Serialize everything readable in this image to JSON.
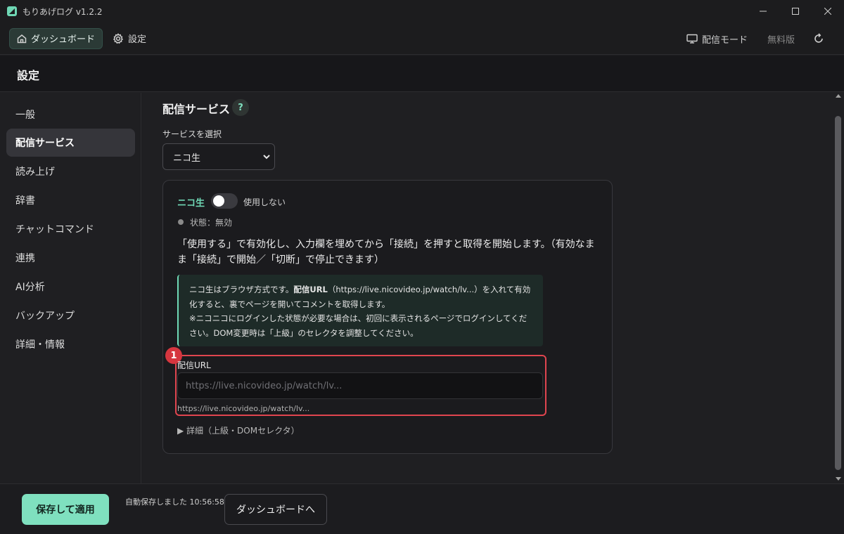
{
  "window": {
    "title": "もりあげログ  v1.2.2"
  },
  "topnav": {
    "dashboard_label": "ダッシュボード",
    "settings_label": "設定",
    "stream_mode_label": "配信モード",
    "plan_label": "無料版"
  },
  "page": {
    "title": "設定"
  },
  "sidebar": {
    "items": [
      {
        "label": "一般",
        "active": false
      },
      {
        "label": "配信サービス",
        "active": true
      },
      {
        "label": "読み上げ",
        "active": false
      },
      {
        "label": "辞書",
        "active": false
      },
      {
        "label": "チャットコマンド",
        "active": false
      },
      {
        "label": "連携",
        "active": false
      },
      {
        "label": "AI分析",
        "active": false
      },
      {
        "label": "バックアップ",
        "active": false
      },
      {
        "label": "詳細・情報",
        "active": false
      }
    ]
  },
  "main": {
    "section_title": "配信サービス",
    "help_label": "?",
    "select_label": "サービスを選択",
    "selected_service": "ニコ生",
    "card": {
      "service_name": "ニコ生",
      "toggle_label": "使用しない",
      "toggle_on": false,
      "status": "状態：無効",
      "description": "「使用する」で有効化し、入力欄を埋めてから「接続」を押すと取得を開始します。（有効なまま「接続」で開始／「切断」で停止できます）",
      "info_part1": "ニコ生はブラウザ方式です。",
      "info_bold": "配信URL",
      "info_part2": "（https://live.nicovideo.jp/watch/lv...）を入れて有効化すると、裏でページを開いてコメントを取得します。",
      "info_part3": "※ニコニコにログインした状態が必要な場合は、初回に表示されるページでログインしてください。DOM変更時は「上級」のセレクタを調整してください。",
      "annotation_badge": "1",
      "url_label": "配信URL",
      "url_placeholder": "https://live.nicovideo.jp/watch/lv...",
      "url_value": "",
      "url_hint": "https://live.nicovideo.jp/watch/lv...",
      "details_label": "▶ 詳細（上級・DOMセレクタ）"
    }
  },
  "footer": {
    "save_label": "保存して適用",
    "autosave_text": "自動保存しました 10:56:58",
    "dashboard_button_label": "ダッシュボードへ"
  },
  "colors": {
    "accent": "#7fe0bf",
    "highlight_border": "#e0454f",
    "badge": "#d6363f"
  }
}
